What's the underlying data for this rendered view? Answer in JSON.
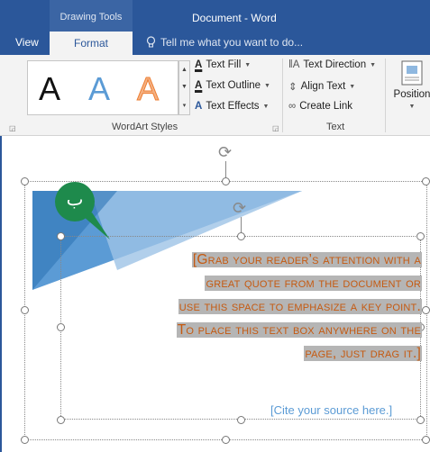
{
  "titlebar": {
    "context_tab": "Drawing Tools",
    "document_title": "Document - Word"
  },
  "ribbon_tabs": {
    "view": "View",
    "format": "Format",
    "tell_me": "Tell me what you want to do..."
  },
  "wordart_styles": {
    "samples": [
      "A",
      "A",
      "A"
    ],
    "text_fill": "Text Fill",
    "text_outline": "Text Outline",
    "text_effects": "Text Effects",
    "group_label": "WordArt Styles"
  },
  "text_group": {
    "text_direction": "Text Direction",
    "align_text": "Align Text",
    "create_link": "Create Link",
    "group_label": "Text"
  },
  "arrange": {
    "position": "Position"
  },
  "document": {
    "quote_lines": [
      "[Grab your reader’s attention with a",
      "great quote from the document or",
      "use this space to emphasize a key point.",
      "To place this text box anywhere on the",
      "page, just drag it.]"
    ],
    "citation": "[Cite your source here.]",
    "callout_label": "ب"
  },
  "colors": {
    "title_bar": "#2b579a",
    "quote_text": "#c55a11",
    "citation_text": "#5b9bd5",
    "callout": "#1e8a4c"
  }
}
